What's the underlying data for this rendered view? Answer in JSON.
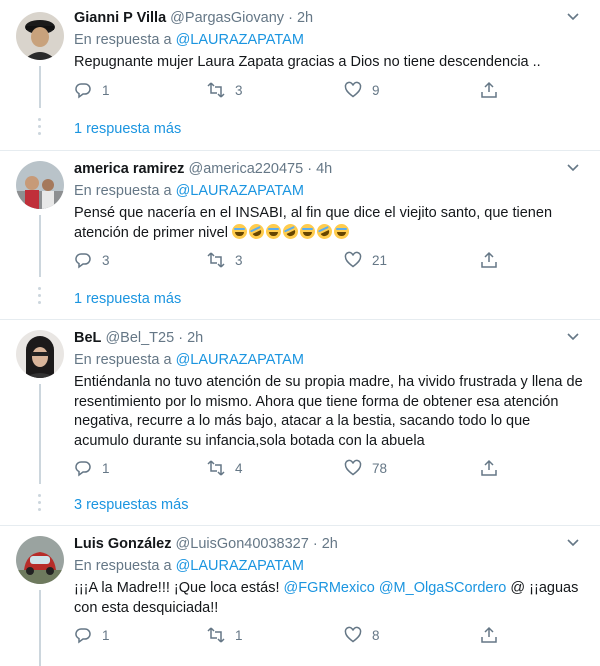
{
  "tweets": [
    {
      "name": "Gianni P Villa",
      "handle": "@PargasGiovany",
      "time": "2h",
      "reply_prefix": "En respuesta a",
      "reply_to": "@LAURAZAPATAM",
      "text": "Repugnante mujer Laura Zapata  gracias a Dios no tiene descendencia ..",
      "replies": "1",
      "retweets": "3",
      "likes": "9",
      "more_replies": "1 respuesta más"
    },
    {
      "name": "america ramirez",
      "handle": "@america220475",
      "time": "4h",
      "reply_prefix": "En respuesta a",
      "reply_to": "@LAURAZAPATAM",
      "text": "Pensé que nacería en el INSABI, al fin que dice el  viejito santo, que tienen atención de primer nivel",
      "emojis": [
        "😂",
        "🤣",
        "😂",
        "🤣",
        "😂",
        "🤣",
        "😂"
      ],
      "replies": "3",
      "retweets": "3",
      "likes": "21",
      "more_replies": "1 respuesta más"
    },
    {
      "name": "BeL",
      "handle": "@Bel_T25",
      "time": "2h",
      "reply_prefix": "En respuesta a",
      "reply_to": "@LAURAZAPATAM",
      "text": "Entiéndanla no tuvo atención de su propia madre, ha vivido frustrada y llena de resentimiento por lo mismo. Ahora que tiene forma de obtener esa atención negativa, recurre a lo más bajo, atacar a la bestia, sacando todo lo que acumulo durante su infancia,sola botada con la abuela",
      "replies": "1",
      "retweets": "4",
      "likes": "78",
      "more_replies": "3 respuestas más"
    },
    {
      "name": "Luis González",
      "handle": "@LuisGon40038327",
      "time": "2h",
      "reply_prefix": "En respuesta a",
      "reply_to": "@LAURAZAPATAM",
      "text_start": "¡¡¡A la Madre!!! ¡Que loca estás!  ",
      "mention1": "@FGRMexico",
      "mention2": "@M_OlgaSCordero",
      "text_end": " @ ¡¡aguas con esta desquiciada!!",
      "replies": "1",
      "retweets": "1",
      "likes": "8"
    }
  ],
  "icons": {
    "reply": "reply-icon",
    "retweet": "retweet-icon",
    "like": "heart-icon",
    "share": "share-icon",
    "caret": "chevron-down-icon"
  }
}
